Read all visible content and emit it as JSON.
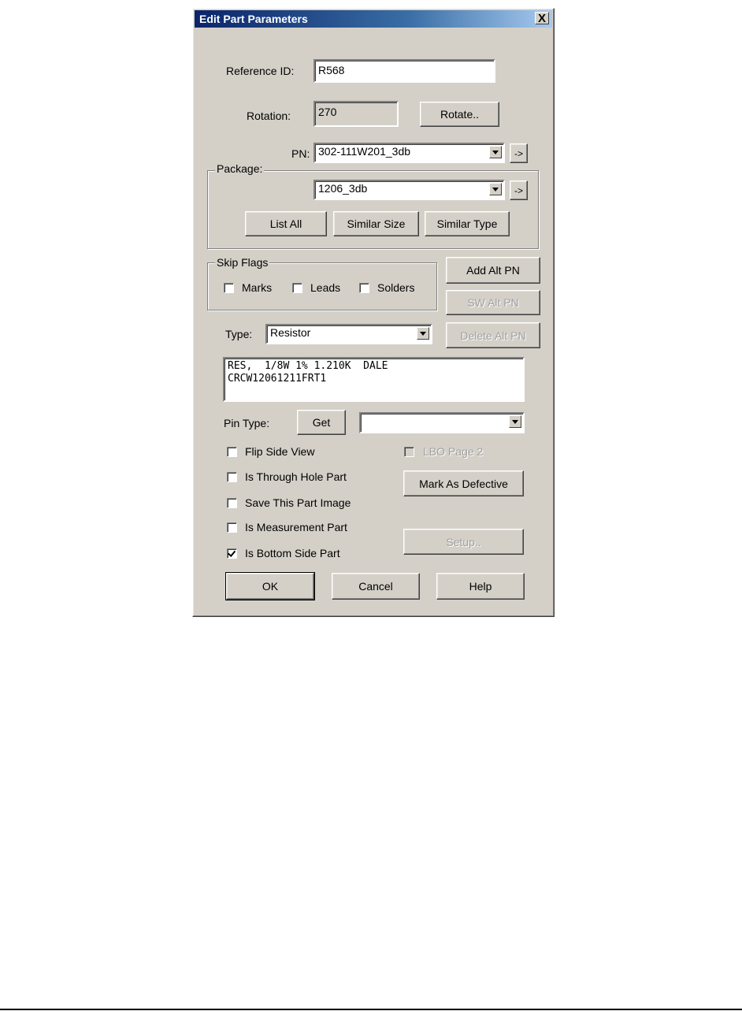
{
  "window": {
    "title": "Edit Part Parameters",
    "close_glyph": "X"
  },
  "reference": {
    "label": "Reference ID:",
    "value": "R568"
  },
  "rotation": {
    "label": "Rotation:",
    "value": "270",
    "button": "Rotate.."
  },
  "pn": {
    "label": "PN:",
    "value": "302-111W201_3db",
    "go": "->"
  },
  "package": {
    "label": "Package:",
    "value": "1206_3db",
    "go": "->",
    "list_all": "List All",
    "similar_size": "Similar Size",
    "similar_type": "Similar Type"
  },
  "skip_flags": {
    "label": "Skip Flags",
    "marks": {
      "label": "Marks",
      "checked": false
    },
    "leads": {
      "label": "Leads",
      "checked": false
    },
    "solders": {
      "label": "Solders",
      "checked": false
    }
  },
  "alt_pn": {
    "add": "Add Alt PN",
    "sw": "SW Alt PN",
    "delete": "Delete Alt PN"
  },
  "type": {
    "label": "Type:",
    "value": "Resistor"
  },
  "description": "RES,  1/8W 1% 1.210K  DALE\nCRCW12061211FRT1",
  "pin_type": {
    "label": "Pin Type:",
    "get": "Get",
    "value": ""
  },
  "options": {
    "flip_side_view": {
      "label": "Flip Side View",
      "checked": false
    },
    "lbo_page2": {
      "label": "LBO Page 2",
      "checked": false,
      "enabled": false
    },
    "through_hole": {
      "label": "Is Through Hole Part",
      "checked": false
    },
    "save_image": {
      "label": "Save This Part Image",
      "checked": false
    },
    "measurement": {
      "label": "Is Measurement Part",
      "checked": false
    },
    "bottom_side": {
      "label": "Is Bottom Side Part",
      "checked": true
    }
  },
  "mark_defective": "Mark As Defective",
  "setup": "Setup..",
  "buttons": {
    "ok": "OK",
    "cancel": "Cancel",
    "help": "Help"
  },
  "colors": {
    "face": "#d4d0c8",
    "title_start": "#0a246a",
    "title_end": "#a6caf0"
  }
}
